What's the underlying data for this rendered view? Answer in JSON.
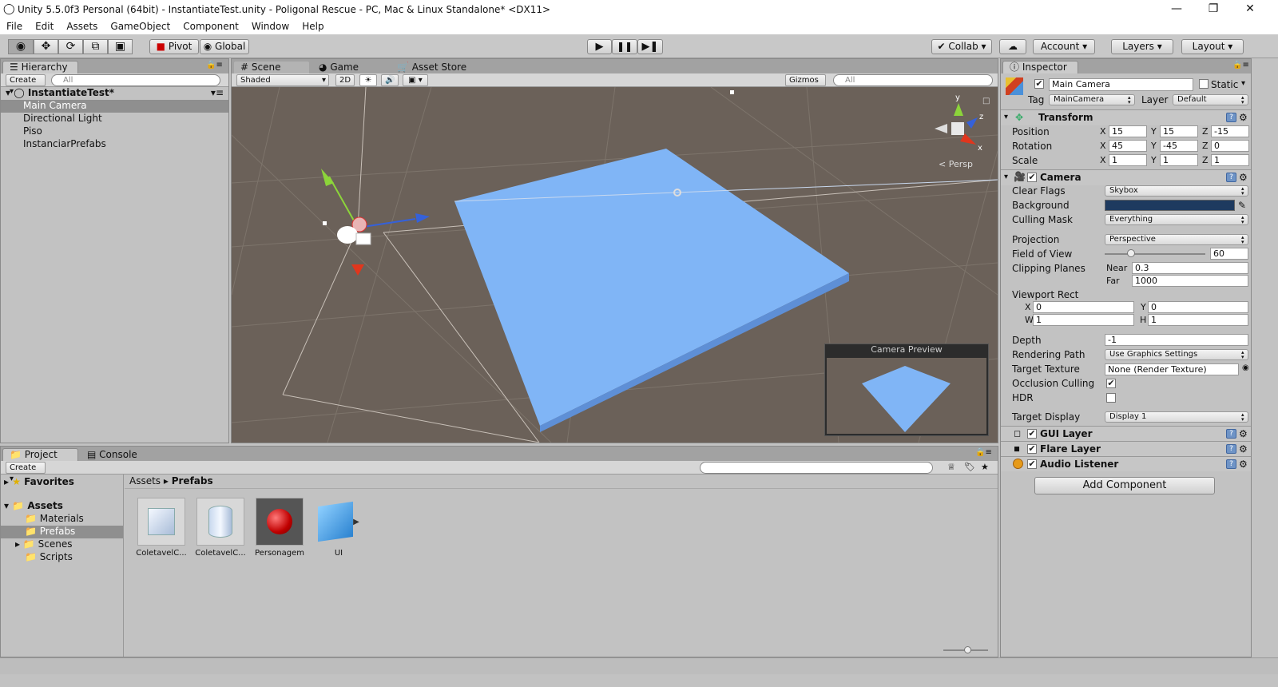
{
  "window": {
    "title": "Unity 5.5.0f3 Personal (64bit) - InstantiateTest.unity - Poligonal Rescue - PC, Mac & Linux Standalone* <DX11>"
  },
  "menu": [
    "File",
    "Edit",
    "Assets",
    "GameObject",
    "Component",
    "Window",
    "Help"
  ],
  "toolbar": {
    "pivot": "Pivot",
    "global": "Global",
    "collab": "Collab",
    "account": "Account",
    "layers": "Layers",
    "layout": "Layout"
  },
  "hierarchy": {
    "tab": "Hierarchy",
    "create": "Create",
    "search": "All",
    "scene": "InstantiateTest*",
    "items": [
      "Main Camera",
      "Directional Light",
      "Piso",
      "InstanciarPrefabs"
    ]
  },
  "scene": {
    "tabs": [
      "Scene",
      "Game",
      "Asset Store"
    ],
    "shading": "Shaded",
    "mode2d": "2D",
    "gizmos": "Gizmos",
    "search": "All",
    "persp": "Persp",
    "axes": {
      "y": "y",
      "z": "z",
      "x": "x"
    },
    "preview_title": "Camera Preview"
  },
  "inspector": {
    "tab": "Inspector",
    "name": "Main Camera",
    "static_label": "Static",
    "tag_label": "Tag",
    "tag": "MainCamera",
    "layer_label": "Layer",
    "layer": "Default",
    "transform": {
      "title": "Transform",
      "rows": [
        {
          "label": "Position",
          "x": "15",
          "y": "15",
          "z": "-15"
        },
        {
          "label": "Rotation",
          "x": "45",
          "y": "-45",
          "z": "0"
        },
        {
          "label": "Scale",
          "x": "1",
          "y": "1",
          "z": "1"
        }
      ]
    },
    "camera": {
      "title": "Camera",
      "clear_flags_label": "Clear Flags",
      "clear_flags": "Skybox",
      "background_label": "Background",
      "background_color": "#1e3a5f",
      "culling_mask_label": "Culling Mask",
      "culling_mask": "Everything",
      "projection_label": "Projection",
      "projection": "Perspective",
      "fov_label": "Field of View",
      "fov": "60",
      "fov_fraction": 0.24,
      "clipping_label": "Clipping Planes",
      "near_label": "Near",
      "near": "0.3",
      "far_label": "Far",
      "far": "1000",
      "viewport_label": "Viewport Rect",
      "vx_label": "X",
      "vx": "0",
      "vy_label": "Y",
      "vy": "0",
      "vw_label": "W",
      "vw": "1",
      "vh_label": "H",
      "vh": "1",
      "depth_label": "Depth",
      "depth": "-1",
      "render_path_label": "Rendering Path",
      "render_path": "Use Graphics Settings",
      "target_texture_label": "Target Texture",
      "target_texture": "None (Render Texture)",
      "occlusion_label": "Occlusion Culling",
      "occlusion": true,
      "hdr_label": "HDR",
      "hdr": false,
      "target_display_label": "Target Display",
      "target_display": "Display 1"
    },
    "components": [
      "GUI Layer",
      "Flare Layer",
      "Audio Listener"
    ],
    "add_component": "Add Component"
  },
  "project": {
    "tabs": [
      "Project",
      "Console"
    ],
    "create": "Create",
    "favorites": "Favorites",
    "assets": "Assets",
    "folders": [
      "Materials",
      "Prefabs",
      "Scenes",
      "Scripts"
    ],
    "breadcrumb": [
      "Assets",
      "Prefabs"
    ],
    "items": [
      "ColetavelC...",
      "ColetavelC...",
      "Personagem",
      "UI"
    ]
  },
  "colors": {
    "plane": "#7eb3f5",
    "scene_bg": "#6b6159",
    "accent": "#3d6fb5"
  }
}
